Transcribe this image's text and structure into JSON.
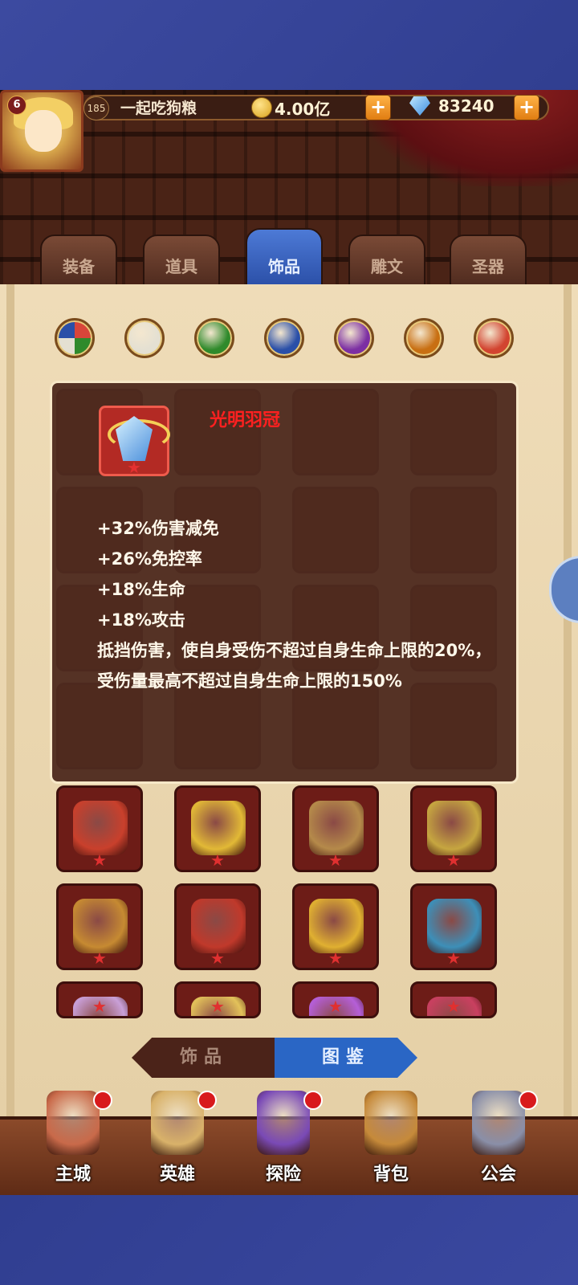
{
  "topbar": {
    "vip_level": "6",
    "level": "185",
    "player_name": "一起吃狗粮",
    "gold": "4.00亿",
    "diamonds": "83240",
    "plus_label": "+",
    "coin_icon": "coin-icon",
    "gem_icon": "diamond-icon"
  },
  "tabs": [
    {
      "label": "装备",
      "active": false
    },
    {
      "label": "道具",
      "active": false
    },
    {
      "label": "饰品",
      "active": true
    },
    {
      "label": "雕文",
      "active": false
    },
    {
      "label": "圣器",
      "active": false
    }
  ],
  "filters": [
    {
      "name": "all-colors",
      "color": "#c8553e"
    },
    {
      "name": "white",
      "color": "#e4e0d2"
    },
    {
      "name": "green",
      "color": "#2f8a2b"
    },
    {
      "name": "blue",
      "color": "#2a4fa8"
    },
    {
      "name": "purple",
      "color": "#7c2fa3"
    },
    {
      "name": "orange",
      "color": "#c86f12"
    },
    {
      "name": "red",
      "color": "#d24430"
    }
  ],
  "tooltip": {
    "item_name": "光明羽冠",
    "item_color": "#ff2020",
    "stats": [
      "+32%伤害减免",
      "+26%免控率",
      "+18%生命",
      "+18%攻击",
      "抵挡伤害，使自身受伤不超过自身生命上限的20%，受伤量最高不超过自身生命上限的150%"
    ]
  },
  "grid_items": [
    {
      "icon": "amulet-icon",
      "color": "#c9402c"
    },
    {
      "icon": "golden-pig-icon",
      "color": "#e2b936"
    },
    {
      "icon": "book-icon",
      "color": "#b58a4a"
    },
    {
      "icon": "golden-eagle-icon",
      "color": "#c6a640"
    },
    {
      "icon": "scroll-book-icon",
      "color": "#c68a32"
    },
    {
      "icon": "eye-icon",
      "color": "#c0392b"
    },
    {
      "icon": "golden-tome-icon",
      "color": "#e0b031"
    },
    {
      "icon": "compass-icon",
      "color": "#3d8fb8"
    },
    {
      "icon": "scroll-icon",
      "color": "#c9a0d8"
    },
    {
      "icon": "feather-icon",
      "color": "#e3c25a"
    },
    {
      "icon": "crystal-icon",
      "color": "#b55fd8"
    },
    {
      "icon": "shell-icon",
      "color": "#c94060"
    }
  ],
  "toggle": {
    "left_label": "饰品",
    "right_label": "图鉴",
    "active": "right"
  },
  "bottom_nav": [
    {
      "label": "主城",
      "icon": "castle-icon",
      "color": "#c96a4a",
      "badge": true
    },
    {
      "label": "英雄",
      "icon": "hero-icon",
      "color": "#d9b26a",
      "badge": true
    },
    {
      "label": "探险",
      "icon": "portal-icon",
      "color": "#7a4ab6",
      "badge": true
    },
    {
      "label": "背包",
      "icon": "bag-icon",
      "color": "#c68a3a",
      "badge": false
    },
    {
      "label": "公会",
      "icon": "guild-tower-icon",
      "color": "#8a8fa8",
      "badge": true
    }
  ]
}
